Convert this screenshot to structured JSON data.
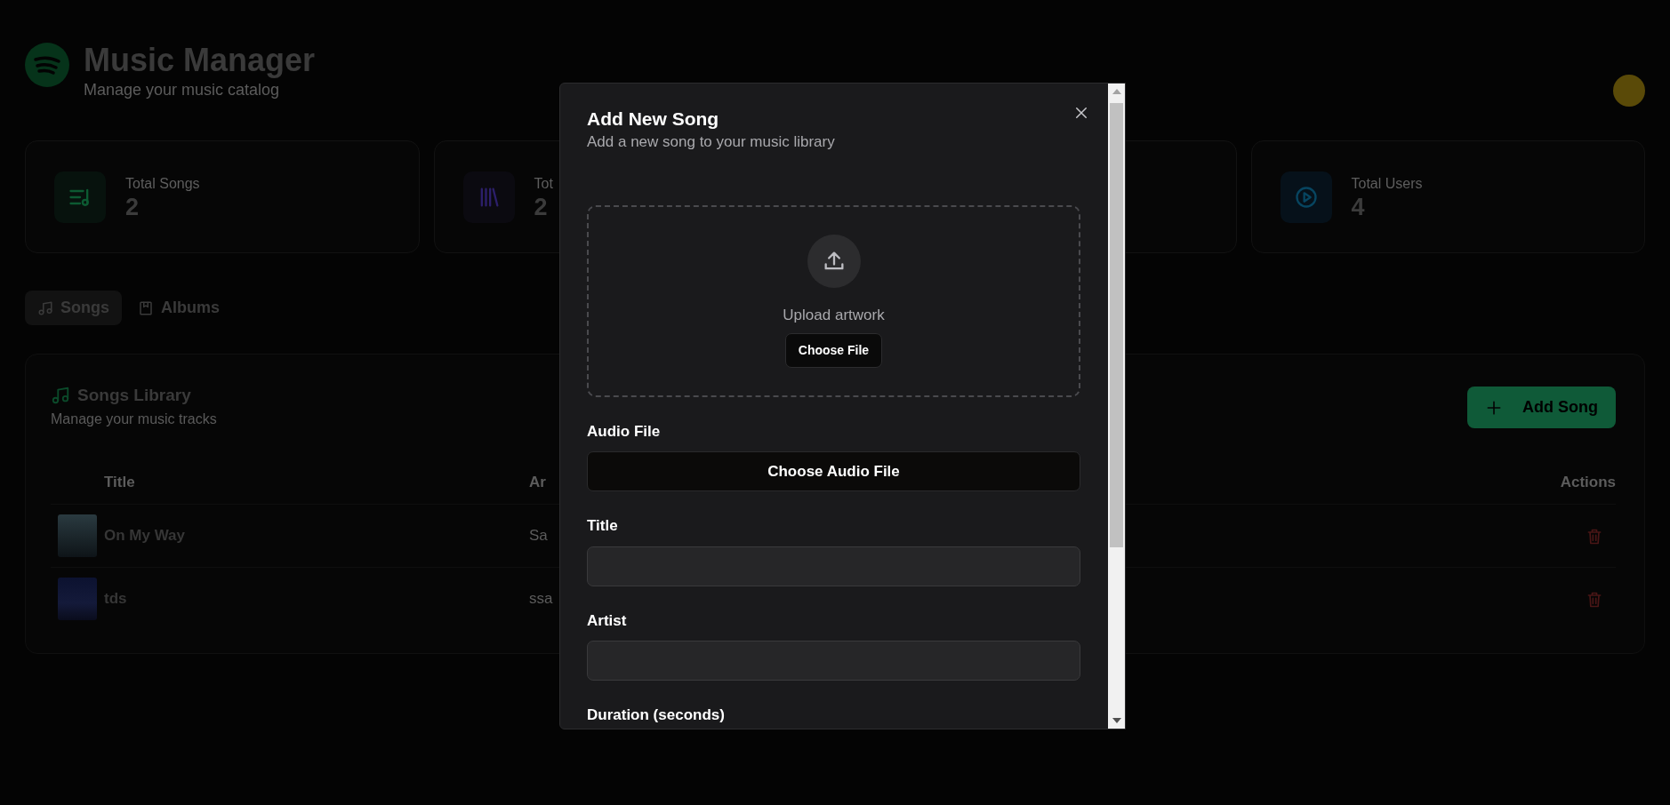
{
  "header": {
    "title": "Music Manager",
    "subtitle": "Manage your music catalog"
  },
  "stats": [
    {
      "kind": "songs",
      "label": "Total Songs",
      "value": "2"
    },
    {
      "kind": "albums",
      "label": "Tot",
      "value": "2"
    },
    {
      "kind": "covered"
    },
    {
      "kind": "users",
      "label": "Total Users",
      "value": "4"
    }
  ],
  "tabs": [
    {
      "kind": "songs",
      "label": "Songs",
      "selected": true
    },
    {
      "kind": "albums",
      "label": "Albums",
      "selected": false
    }
  ],
  "library": {
    "title": "Songs Library",
    "subtitle": "Manage your music tracks",
    "add_button": "Add Song",
    "columns": [
      "Title",
      "Ar",
      "Actions"
    ],
    "rows": [
      {
        "title": "On My Way",
        "artist": "Sa"
      },
      {
        "title": "tds",
        "artist": "ssa"
      }
    ]
  },
  "modal": {
    "title": "Add New Song",
    "subtitle": "Add a new song to your music library",
    "upload": {
      "label": "Upload artwork",
      "button": "Choose File"
    },
    "fields": [
      {
        "kind": "file",
        "label": "Audio File",
        "button": "Choose Audio File"
      },
      {
        "kind": "text",
        "label": "Title"
      },
      {
        "kind": "text",
        "label": "Artist"
      },
      {
        "kind": "label_only",
        "label": "Duration (seconds)"
      }
    ]
  }
}
